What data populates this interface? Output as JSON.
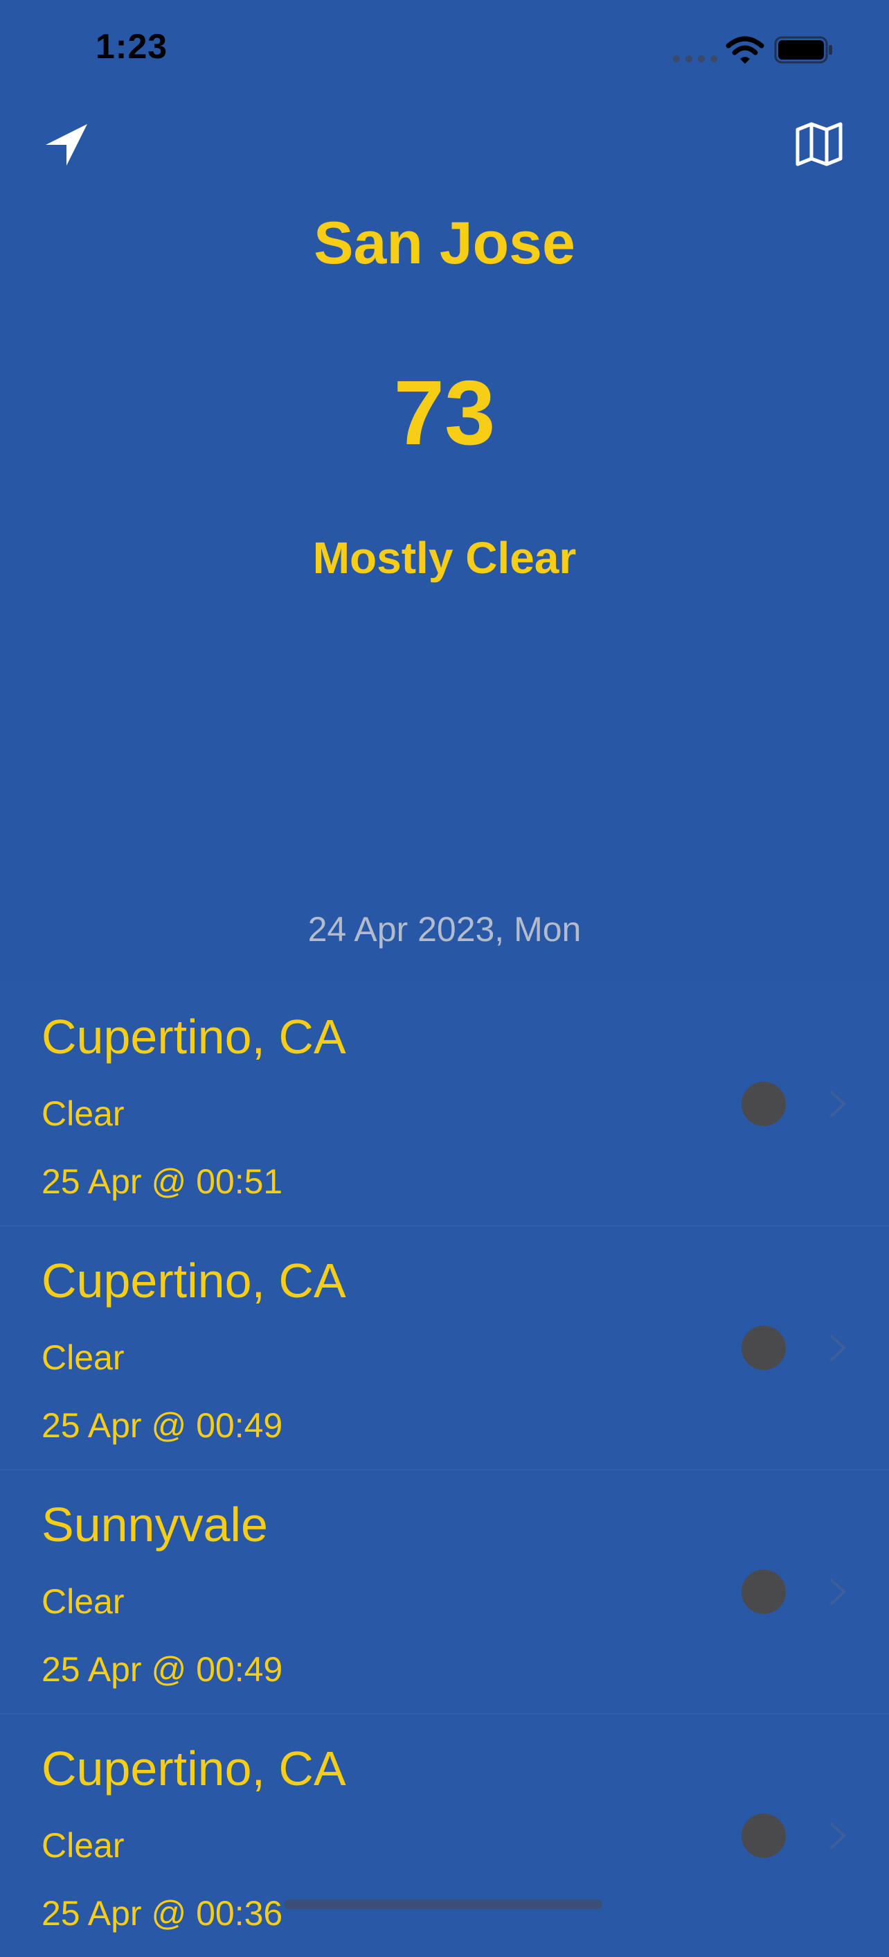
{
  "status_bar": {
    "time": "1:23",
    "icons": [
      "cellular-icon",
      "wifi-icon",
      "battery-icon"
    ]
  },
  "nav": {
    "left_icon": "location-arrow-icon",
    "right_icon": "map-icon"
  },
  "current": {
    "city": "San Jose",
    "temperature": "73",
    "condition": "Mostly Clear"
  },
  "section_date": "24 Apr 2023, Mon",
  "history": [
    {
      "city": "Cupertino, CA",
      "condition": "Clear",
      "time": "25 Apr @ 00:51"
    },
    {
      "city": "Cupertino, CA",
      "condition": "Clear",
      "time": "25 Apr @ 00:49"
    },
    {
      "city": "Sunnyvale",
      "condition": "Clear",
      "time": "25 Apr @ 00:49"
    },
    {
      "city": "Cupertino, CA",
      "condition": "Clear",
      "time": "25 Apr @ 00:36"
    }
  ],
  "colors": {
    "background": "#2757a5",
    "accent": "#f8cd16",
    "muted_text": "#b4bccc",
    "dot": "#4a4a4d"
  }
}
